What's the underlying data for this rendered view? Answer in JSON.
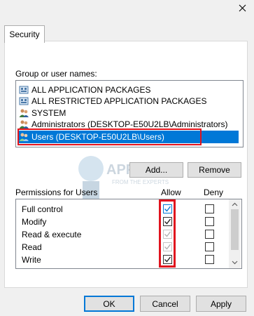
{
  "window": {
    "close_icon": "close-icon"
  },
  "tabs": [
    {
      "label": "Security"
    }
  ],
  "group_list": {
    "label": "Group or user names:",
    "items": [
      {
        "name": "ALL APPLICATION PACKAGES",
        "icon": "package-group-icon",
        "selected": false
      },
      {
        "name": "ALL RESTRICTED APPLICATION PACKAGES",
        "icon": "package-group-icon",
        "selected": false
      },
      {
        "name": "SYSTEM",
        "icon": "users-group-icon",
        "selected": false
      },
      {
        "name": "Administrators (DESKTOP-E50U2LB\\Administrators)",
        "icon": "users-group-icon",
        "selected": false
      },
      {
        "name": "Users (DESKTOP-E50U2LB\\Users)",
        "icon": "users-group-icon",
        "selected": true
      }
    ]
  },
  "buttons": {
    "add": "Add...",
    "remove": "Remove",
    "ok": "OK",
    "cancel": "Cancel",
    "apply": "Apply"
  },
  "permissions": {
    "title": "Permissions for Users",
    "allow_header": "Allow",
    "deny_header": "Deny",
    "rows": [
      {
        "name": "Full control",
        "allow": true,
        "allow_enabled": true,
        "deny": false
      },
      {
        "name": "Modify",
        "allow": true,
        "allow_enabled": true,
        "deny": false
      },
      {
        "name": "Read & execute",
        "allow": true,
        "allow_enabled": false,
        "deny": false
      },
      {
        "name": "Read",
        "allow": true,
        "allow_enabled": false,
        "deny": false
      },
      {
        "name": "Write",
        "allow": true,
        "allow_enabled": true,
        "deny": false
      }
    ]
  },
  "watermark": {
    "line1": "APPUALS",
    "line2": "FROM THE EXPERTS"
  },
  "colors": {
    "selection": "#0078d7",
    "highlight_frame": "#e0141e",
    "check_enabled": "#1e1e1e",
    "check_disabled": "#b0b0b0"
  }
}
